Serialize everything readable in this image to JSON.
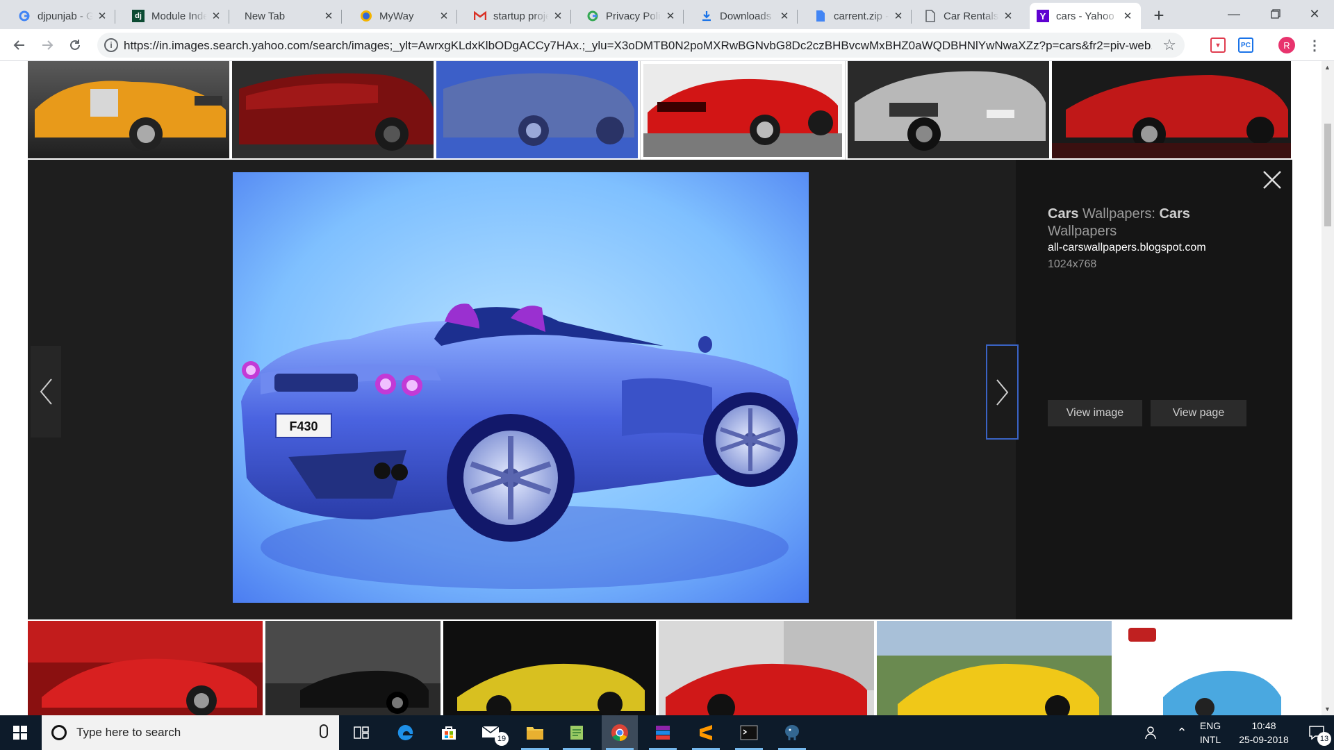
{
  "browser": {
    "tabs": [
      {
        "title": "djpunjab - Google",
        "icon": "google-icon"
      },
      {
        "title": "Module Index",
        "icon": "django-icon"
      },
      {
        "title": "New Tab",
        "icon": "none"
      },
      {
        "title": "MyWay",
        "icon": "myway-icon"
      },
      {
        "title": "startup project",
        "icon": "gmail-icon"
      },
      {
        "title": "Privacy Policy",
        "icon": "google-icon"
      },
      {
        "title": "Downloads",
        "icon": "download-icon"
      },
      {
        "title": "carrent.zip - ",
        "icon": "doc-icon"
      },
      {
        "title": "Car Rentals",
        "icon": "page-icon"
      },
      {
        "title": "cars - Yahoo",
        "icon": "yahoo-icon",
        "active": true
      }
    ],
    "url": "https://in.images.search.yahoo.com/search/images;_ylt=AwrxgKLdxKlbODgACCy7HAx.;_ylu=X3oDMTB0N2poMXRwBGNvbG8Dc2czBHBvcwMxBHZ0aWQDBHNlYwNwaXZz?p=cars&fr2=piv-web...",
    "extensions": [
      "pocket-icon",
      "pc-icon"
    ],
    "profile_initial": "R"
  },
  "viewer": {
    "title_bold_1": "Cars",
    "title_plain_1": " Wallpapers: ",
    "title_bold_2": "Cars",
    "title_plain_2": " Wallpapers",
    "source": "all-carswallpapers.blogspot.com",
    "dimensions": "1024x768",
    "view_image": "View image",
    "view_page": "View page",
    "plate_text": "F430"
  },
  "thumbnails_top": [
    "orange-mg-car",
    "red-audi-concept",
    "blue-ferrari-spider",
    "red-dodge-viper",
    "silver-audi-concept",
    "red-ferrari-599"
  ],
  "thumbnails_bottom": [
    "red-ferrari-concept",
    "black-spider",
    "yellow-corvette",
    "red-ferrari-458",
    "yellow-ferrari-458",
    "cars-movie-king"
  ],
  "taskbar": {
    "search_placeholder": "Type here to search",
    "mail_badge": "19",
    "language_line1": "ENG",
    "language_line2": "INTL",
    "time": "10:48",
    "date": "25-09-2018",
    "notifications": "13",
    "apps": [
      "task-view-icon",
      "edge-icon",
      "store-icon",
      "mail-icon",
      "file-explorer-icon",
      "notepad-icon",
      "chrome-icon",
      "winrar-icon",
      "sublime-icon",
      "terminal-icon",
      "postgres-icon"
    ]
  },
  "colors": {
    "tabstrip": "#dee1e6",
    "viewer_bg": "#1e1e1e",
    "taskbar": "#0d1b2a",
    "right_arrow_border": "#3a63c4",
    "avatar": "#e8336d"
  }
}
